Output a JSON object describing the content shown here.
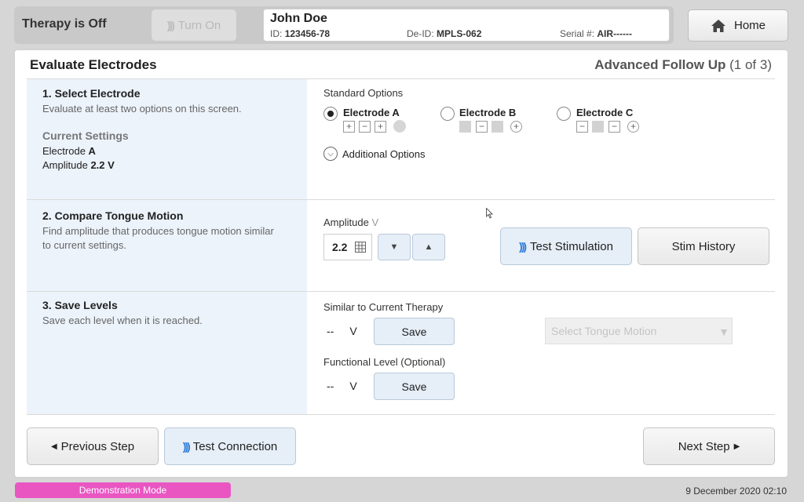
{
  "header": {
    "therapy_status": "Therapy is Off",
    "turn_on_label": "Turn On",
    "patient": {
      "name": "John Doe",
      "id_label": "ID:",
      "id": "123456-78",
      "deid_label": "De-ID:",
      "deid": "MPLS-062",
      "serial_label": "Serial #:",
      "serial": "AIR------"
    },
    "home_label": "Home"
  },
  "card": {
    "title": "Evaluate Electrodes",
    "mode": "Advanced Follow Up",
    "progress": "(1 of 3)"
  },
  "step1": {
    "title": "1. Select Electrode",
    "desc": "Evaluate at least two options on this screen.",
    "current_settings_label": "Current Settings",
    "electrode_prefix": "Electrode",
    "electrode_value": "A",
    "amplitude_prefix": "Amplitude",
    "amplitude_value": "2.2 V",
    "standard_options_label": "Standard Options",
    "options": [
      {
        "label": "Electrode A",
        "selected": true
      },
      {
        "label": "Electrode B",
        "selected": false
      },
      {
        "label": "Electrode C",
        "selected": false
      }
    ],
    "additional_options_label": "Additional Options"
  },
  "step2": {
    "title": "2. Compare Tongue Motion",
    "desc": "Find amplitude that produces tongue motion similar to current settings.",
    "amplitude_label": "Amplitude",
    "amplitude_unit": "V",
    "amplitude_value": "2.2",
    "test_stim_label": "Test Stimulation",
    "stim_history_label": "Stim History"
  },
  "step3": {
    "title": "3. Save Levels",
    "desc": "Save each level when it is reached.",
    "similar_label": "Similar to Current Therapy",
    "similar_value": "--",
    "unit": "V",
    "save_label": "Save",
    "functional_label": "Functional Level (Optional)",
    "functional_value": "--",
    "select_tongue_placeholder": "Select Tongue Motion"
  },
  "footer": {
    "prev_label": "Previous Step",
    "test_conn_label": "Test Connection",
    "next_label": "Next Step"
  },
  "status": {
    "demo_mode": "Demonstration Mode",
    "datetime": "9 December 2020 02:10"
  },
  "colors": {
    "accent_blue": "#2b7bd6",
    "demo_pink": "#e956c2",
    "panel_blue": "#ecf3fb"
  }
}
